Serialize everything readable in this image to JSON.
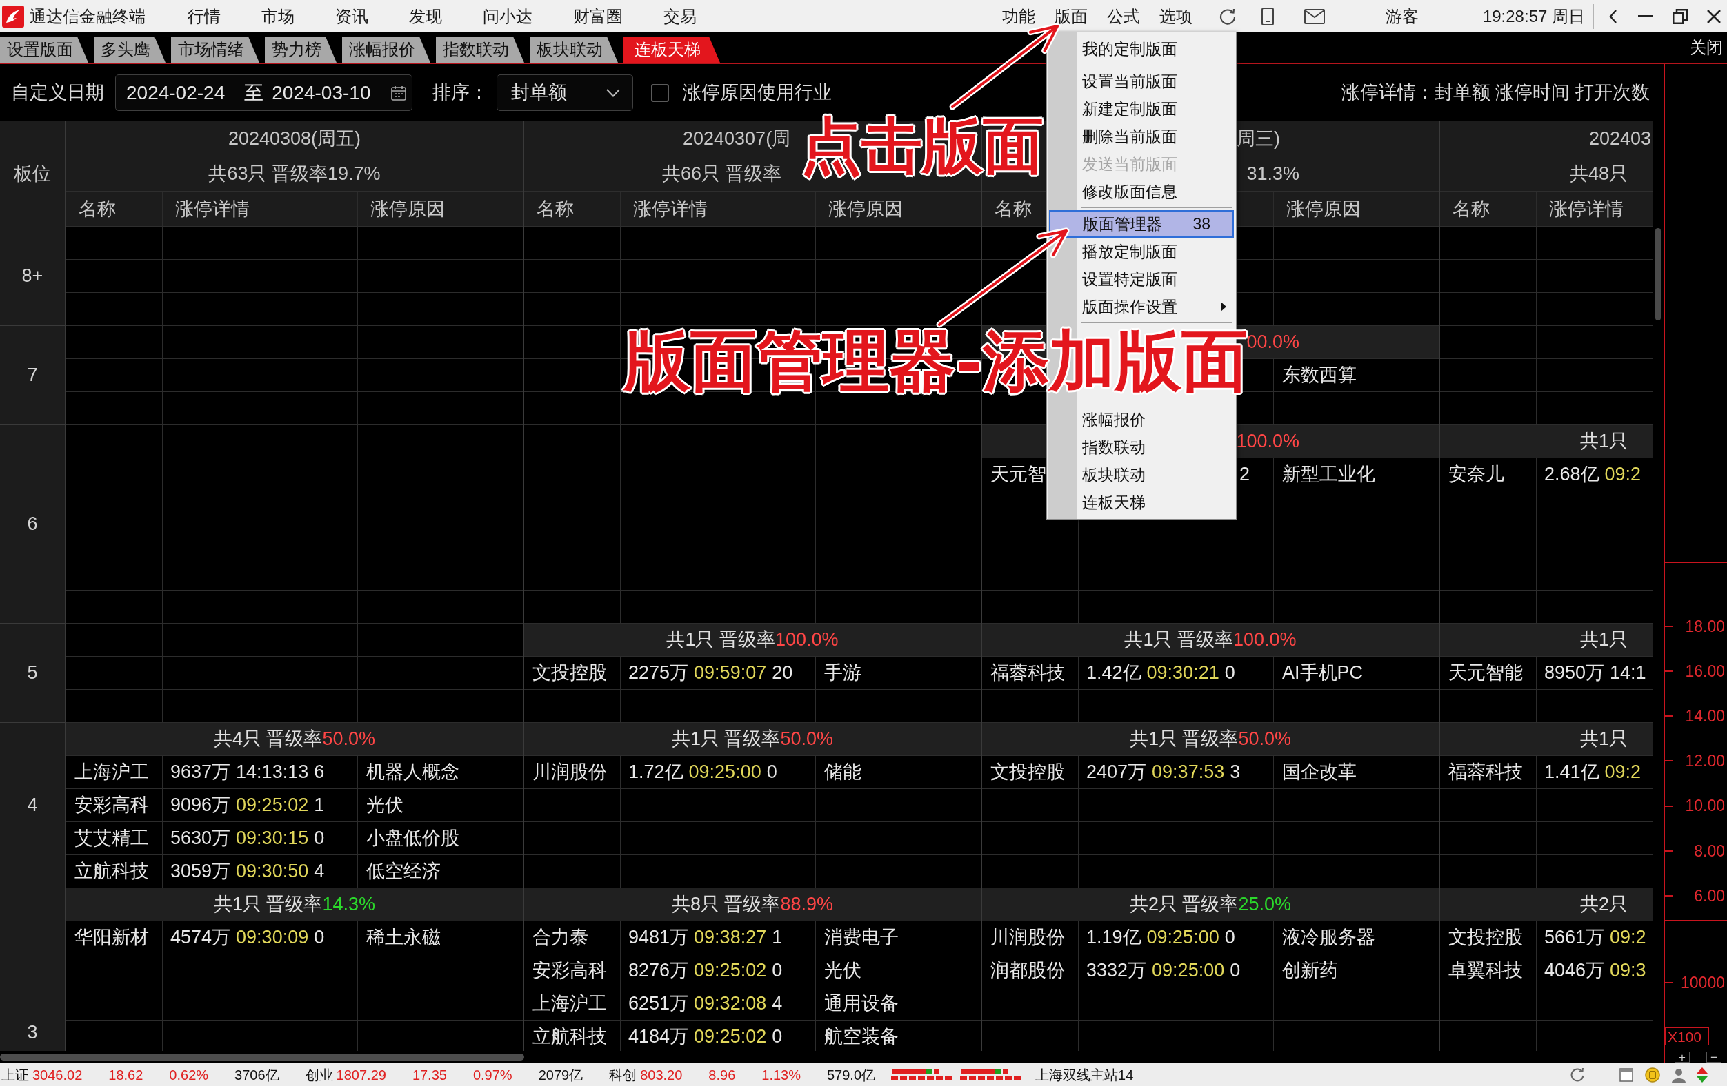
{
  "app": {
    "title": "通达信金融终端",
    "menus": [
      "行情",
      "市场",
      "资讯",
      "发现",
      "问小达",
      "财富圈",
      "交易"
    ],
    "tools": [
      "功能",
      "版面",
      "公式",
      "选项"
    ],
    "user": "游客",
    "clock": "19:28:57 周日"
  },
  "menu": {
    "sections": [
      {
        "items": [
          {
            "label": "我的定制版面",
            "selected": false,
            "disabled": false,
            "submenu": false
          }
        ]
      },
      {
        "items": [
          {
            "label": "设置当前版面",
            "selected": false,
            "disabled": false,
            "submenu": false
          },
          {
            "label": "新建定制版面",
            "selected": false,
            "disabled": false,
            "submenu": false
          },
          {
            "label": "删除当前版面",
            "selected": false,
            "disabled": false,
            "submenu": false
          },
          {
            "label": "发送当前版面",
            "selected": false,
            "disabled": true,
            "submenu": false
          },
          {
            "label": "修改版面信息",
            "selected": false,
            "disabled": false,
            "submenu": false
          }
        ]
      },
      {
        "items": [
          {
            "label": "版面管理器",
            "shortcut": "38",
            "selected": true,
            "disabled": false,
            "submenu": false
          },
          {
            "label": "播放定制版面",
            "selected": false,
            "disabled": false,
            "submenu": false
          },
          {
            "label": "设置特定版面",
            "selected": false,
            "disabled": false,
            "submenu": false
          },
          {
            "label": "版面操作设置",
            "selected": false,
            "disabled": false,
            "submenu": true
          }
        ]
      },
      {
        "items": [
          {
            "label": "涨幅报价",
            "selected": false,
            "disabled": false,
            "submenu": false
          },
          {
            "label": "指数联动",
            "selected": false,
            "disabled": false,
            "submenu": false
          },
          {
            "label": "板块联动",
            "selected": false,
            "disabled": false,
            "submenu": false
          },
          {
            "label": "连板天梯",
            "selected": false,
            "disabled": false,
            "submenu": false
          }
        ]
      }
    ]
  },
  "tabs": [
    {
      "label": "设置版面",
      "selected": false
    },
    {
      "label": "多头鹰",
      "selected": false
    },
    {
      "label": "市场情绪",
      "selected": false
    },
    {
      "label": "势力榜",
      "selected": false
    },
    {
      "label": "涨幅报价",
      "selected": false
    },
    {
      "label": "指数联动",
      "selected": false
    },
    {
      "label": "板块联动",
      "selected": false
    },
    {
      "label": "连板天梯",
      "selected": true
    }
  ],
  "close_label": "关闭",
  "filters": {
    "date_label": "自定义日期",
    "date_from": "2024-02-24",
    "date_separator": "至",
    "date_to": "2024-03-10",
    "sort_label": "排序：",
    "sort_value": "封单额",
    "industry_option": {
      "label": "涨停原因使用行业",
      "checked": false
    },
    "legend": "涨停详情：封单额 涨停时间 打开次数"
  },
  "ladder": {
    "level_header": "板位",
    "groups": [
      {
        "date": {
          "text": "20240308(周五)"
        },
        "summary": {
          "text": "共63只 晋级率19.7%"
        },
        "headers": {
          "name": "名称",
          "detail": "涨停详情",
          "reason": "涨停原因"
        },
        "clipped": false
      },
      {
        "date": {
          "text": "20240307(周",
          "cut_end": true
        },
        "summary": {
          "text": "共66只 晋级率",
          "cut_end": true
        },
        "headers": {
          "name": "名称",
          "detail": "涨停详情",
          "reason": "涨停原因"
        },
        "clipped": false
      },
      {
        "date": {
          "text": "周三)",
          "cut_start": true
        },
        "summary": {
          "text": "31.3%",
          "cut_start": true
        },
        "headers": {
          "name": "名称",
          "reason": "涨停原因"
        },
        "clipped": false
      },
      {
        "date": {
          "text": "202403"
        },
        "summary": {
          "text": "共48只"
        },
        "headers": {
          "name": "名称",
          "detail": "涨停详情"
        },
        "clipped": true
      }
    ],
    "levels": [
      {
        "label": "8+",
        "continues": false,
        "rows": [
          [
            {
              "kind": "empty"
            },
            {
              "kind": "empty"
            },
            {
              "kind": "empty"
            },
            {
              "kind": "empty"
            }
          ],
          [
            {
              "kind": "empty"
            },
            {
              "kind": "empty"
            },
            {
              "kind": "empty"
            },
            {
              "kind": "empty"
            }
          ],
          [
            {
              "kind": "empty"
            },
            {
              "kind": "empty"
            },
            {
              "kind": "empty"
            },
            {
              "kind": "empty"
            }
          ]
        ]
      },
      {
        "label": "7",
        "continues": false,
        "rows": [
          [
            {
              "kind": "empty"
            },
            {
              "kind": "empty"
            },
            {
              "kind": "summary",
              "rate": {
                "text": "00.0%",
                "color": "#ff4646"
              },
              "cut_start": true
            },
            {
              "kind": "empty"
            }
          ],
          [
            {
              "kind": "empty"
            },
            {
              "kind": "empty"
            },
            {
              "kind": "stock",
              "reason": "东数西算"
            },
            {
              "kind": "empty"
            }
          ],
          [
            {
              "kind": "empty"
            },
            {
              "kind": "empty"
            },
            {
              "kind": "empty"
            },
            {
              "kind": "empty"
            }
          ]
        ]
      },
      {
        "label": "6",
        "continues": false,
        "rows": [
          [
            {
              "kind": "empty"
            },
            {
              "kind": "empty"
            },
            {
              "kind": "summary",
              "rate": {
                "text": "100.0%",
                "color": "#ff4646"
              },
              "cut_start": true
            },
            {
              "kind": "summary",
              "count": "共1只"
            }
          ],
          [
            {
              "kind": "empty"
            },
            {
              "kind": "empty"
            },
            {
              "kind": "stock",
              "name": "天元智",
              "detail": {
                "opens": "2"
              },
              "reason": "新型工业化"
            },
            {
              "kind": "stock",
              "name": "安奈儿",
              "detail": {
                "amount": "2.68亿",
                "time": {
                  "text": "09:2",
                  "color": "#e1d75a"
                }
              }
            }
          ],
          [
            {
              "kind": "empty"
            },
            {
              "kind": "empty"
            },
            {
              "kind": "empty"
            },
            {
              "kind": "empty"
            }
          ],
          [
            {
              "kind": "empty"
            },
            {
              "kind": "empty"
            },
            {
              "kind": "empty"
            },
            {
              "kind": "empty"
            }
          ],
          [
            {
              "kind": "empty"
            },
            {
              "kind": "empty"
            },
            {
              "kind": "empty"
            },
            {
              "kind": "empty"
            }
          ],
          [
            {
              "kind": "empty"
            },
            {
              "kind": "empty"
            },
            {
              "kind": "empty"
            },
            {
              "kind": "empty"
            }
          ]
        ]
      },
      {
        "label": "5",
        "continues": false,
        "rows": [
          [
            {
              "kind": "empty"
            },
            {
              "kind": "summary",
              "count": "共1只 晋级率",
              "rate": {
                "text": "100.0%",
                "color": "#ff4646"
              }
            },
            {
              "kind": "summary",
              "count": "共1只 晋级率",
              "rate": {
                "text": "100.0%",
                "color": "#ff4646"
              }
            },
            {
              "kind": "summary",
              "count": "共1只"
            }
          ],
          [
            {
              "kind": "empty"
            },
            {
              "kind": "stock",
              "name": "文投控股",
              "detail": {
                "amount": "2275万",
                "time": {
                  "text": "09:59:07",
                  "color": "#e1d75a"
                },
                "opens": "20"
              },
              "reason": "手游"
            },
            {
              "kind": "stock",
              "name": "福蓉科技",
              "detail": {
                "amount": "1.42亿",
                "time": {
                  "text": "09:30:21",
                  "color": "#e1d75a"
                },
                "opens": "0"
              },
              "reason": "AI手机PC"
            },
            {
              "kind": "stock",
              "name": "天元智能",
              "detail": {
                "amount": "8950万",
                "time": {
                  "text": "14:1",
                  "color": "#e6e6e6"
                }
              }
            }
          ],
          [
            {
              "kind": "empty"
            },
            {
              "kind": "empty"
            },
            {
              "kind": "empty"
            },
            {
              "kind": "empty"
            }
          ]
        ]
      },
      {
        "label": "4",
        "continues": false,
        "rows": [
          [
            {
              "kind": "summary",
              "count": "共4只 晋级率",
              "rate": {
                "text": "50.0%",
                "color": "#ff4646"
              }
            },
            {
              "kind": "summary",
              "count": "共1只 晋级率",
              "rate": {
                "text": "50.0%",
                "color": "#ff4646"
              }
            },
            {
              "kind": "summary",
              "count": "共1只 晋级率",
              "rate": {
                "text": "50.0%",
                "color": "#ff4646"
              }
            },
            {
              "kind": "summary",
              "count": "共1只"
            }
          ],
          [
            {
              "kind": "stock",
              "name": "上海沪工",
              "detail": {
                "amount": "9637万",
                "time": {
                  "text": "14:13:13",
                  "color": "#e6e6e6"
                },
                "opens": "6"
              },
              "reason": "机器人概念"
            },
            {
              "kind": "stock",
              "name": "川润股份",
              "detail": {
                "amount": "1.72亿",
                "time": {
                  "text": "09:25:00",
                  "color": "#e1d75a"
                },
                "opens": "0"
              },
              "reason": "储能"
            },
            {
              "kind": "stock",
              "name": "文投控股",
              "detail": {
                "amount": "2407万",
                "time": {
                  "text": "09:37:53",
                  "color": "#e1d75a"
                },
                "opens": "3"
              },
              "reason": "国企改革"
            },
            {
              "kind": "stock",
              "name": "福蓉科技",
              "detail": {
                "amount": "1.41亿",
                "time": {
                  "text": "09:2",
                  "color": "#e1d75a"
                }
              }
            }
          ],
          [
            {
              "kind": "stock",
              "name": "安彩高科",
              "detail": {
                "amount": "9096万",
                "time": {
                  "text": "09:25:02",
                  "color": "#e1d75a"
                },
                "opens": "1"
              },
              "reason": "光伏"
            },
            {
              "kind": "empty"
            },
            {
              "kind": "empty"
            },
            {
              "kind": "empty"
            }
          ],
          [
            {
              "kind": "stock",
              "name": "艾艾精工",
              "detail": {
                "amount": "5630万",
                "time": {
                  "text": "09:30:15",
                  "color": "#e1d75a"
                },
                "opens": "0"
              },
              "reason": "小盘低价股"
            },
            {
              "kind": "empty"
            },
            {
              "kind": "empty"
            },
            {
              "kind": "empty"
            }
          ],
          [
            {
              "kind": "stock",
              "name": "立航科技",
              "detail": {
                "amount": "3059万",
                "time": {
                  "text": "09:30:50",
                  "color": "#e1d75a"
                },
                "opens": "4"
              },
              "reason": "低空经济"
            },
            {
              "kind": "empty"
            },
            {
              "kind": "empty"
            },
            {
              "kind": "empty"
            }
          ]
        ]
      },
      {
        "label": "3",
        "continues": true,
        "rows": [
          [
            {
              "kind": "summary",
              "count": "共1只 晋级率",
              "rate": {
                "text": "14.3%",
                "color": "#2bd92b"
              }
            },
            {
              "kind": "summary",
              "count": "共8只 晋级率",
              "rate": {
                "text": "88.9%",
                "color": "#ff4646"
              }
            },
            {
              "kind": "summary",
              "count": "共2只 晋级率",
              "rate": {
                "text": "25.0%",
                "color": "#2bd92b"
              }
            },
            {
              "kind": "summary",
              "count": "共2只"
            }
          ],
          [
            {
              "kind": "stock",
              "name": "华阳新材",
              "detail": {
                "amount": "4574万",
                "time": {
                  "text": "09:30:09",
                  "color": "#e1d75a"
                },
                "opens": "0"
              },
              "reason": "稀土永磁"
            },
            {
              "kind": "stock",
              "name": "合力泰",
              "detail": {
                "amount": "9481万",
                "time": {
                  "text": "09:38:27",
                  "color": "#e1d75a"
                },
                "opens": "1"
              },
              "reason": "消费电子"
            },
            {
              "kind": "stock",
              "name": "川润股份",
              "detail": {
                "amount": "1.19亿",
                "time": {
                  "text": "09:25:00",
                  "color": "#e1d75a"
                },
                "opens": "0"
              },
              "reason": "液冷服务器"
            },
            {
              "kind": "stock",
              "name": "文投控股",
              "detail": {
                "amount": "5661万",
                "time": {
                  "text": "09:2",
                  "color": "#e1d75a"
                }
              }
            }
          ],
          [
            {
              "kind": "empty"
            },
            {
              "kind": "stock",
              "name": "安彩高科",
              "detail": {
                "amount": "8276万",
                "time": {
                  "text": "09:25:02",
                  "color": "#e1d75a"
                },
                "opens": "0"
              },
              "reason": "光伏"
            },
            {
              "kind": "stock",
              "name": "润都股份",
              "detail": {
                "amount": "3332万",
                "time": {
                  "text": "09:25:00",
                  "color": "#e1d75a"
                },
                "opens": "0"
              },
              "reason": "创新药"
            },
            {
              "kind": "stock",
              "name": "卓翼科技",
              "detail": {
                "amount": "4046万",
                "time": {
                  "text": "09:3",
                  "color": "#e1d75a"
                }
              }
            }
          ],
          [
            {
              "kind": "empty"
            },
            {
              "kind": "stock",
              "name": "上海沪工",
              "detail": {
                "amount": "6251万",
                "time": {
                  "text": "09:32:08",
                  "color": "#e1d75a"
                },
                "opens": "4"
              },
              "reason": "通用设备"
            },
            {
              "kind": "empty"
            },
            {
              "kind": "empty"
            }
          ],
          [
            {
              "kind": "empty"
            },
            {
              "kind": "stock",
              "name": "立航科技",
              "detail": {
                "amount": "4184万",
                "time": {
                  "text": "09:25:02",
                  "color": "#e1d75a"
                },
                "opens": "0"
              },
              "reason": "航空装备"
            },
            {
              "kind": "empty"
            },
            {
              "kind": "empty"
            }
          ]
        ]
      }
    ]
  },
  "side_chart": {
    "price_ticks": [
      "18.00",
      "16.00",
      "14.00",
      "12.00",
      "10.00",
      "8.00",
      "6.00"
    ],
    "volume_tick": "10000",
    "scale": "X100",
    "zoom_controls": [
      "+",
      "−"
    ]
  },
  "status_bar": {
    "indices": [
      {
        "name": "上证",
        "value": "3046.02",
        "change": "18.62",
        "percent": "0.62%",
        "turnover": "3706亿",
        "color": "#e02020"
      },
      {
        "name": "创业",
        "value": "1807.29",
        "change": "17.35",
        "percent": "0.97%",
        "turnover": "2079亿",
        "color": "#e02020"
      },
      {
        "name": "科创",
        "value": "803.20",
        "change": "8.96",
        "percent": "1.13%",
        "turnover": "579.0亿",
        "color": "#e02020"
      }
    ],
    "server": "上海双线主站14"
  },
  "annotations": [
    {
      "text": "点击版面"
    },
    {
      "text": "版面管理器-添加版面"
    }
  ]
}
